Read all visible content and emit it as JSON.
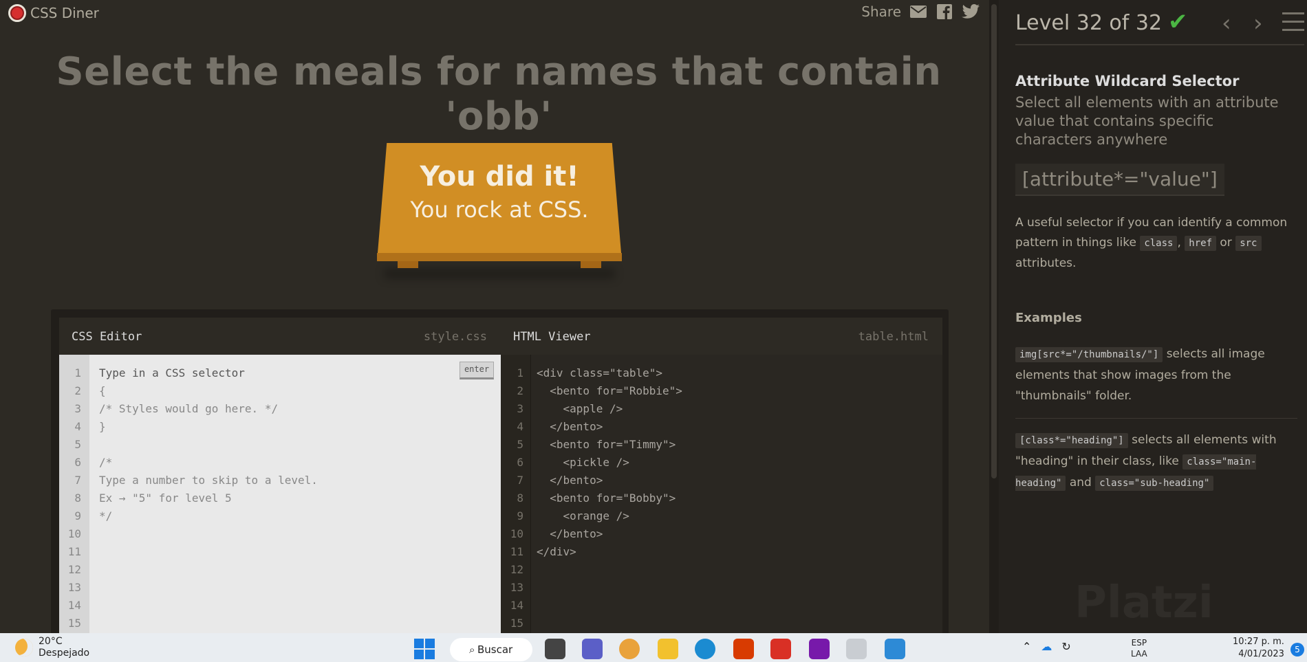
{
  "app": {
    "name": "CSS Diner"
  },
  "share": {
    "label": "Share"
  },
  "instruction": "Select the meals for names that contain 'obb'",
  "plate": {
    "line1": "You did it!",
    "line2": "You rock at CSS."
  },
  "css_editor": {
    "title": "CSS Editor",
    "filename": "style.css",
    "enter_label": "enter",
    "line_numbers": [
      "1",
      "2",
      "3",
      "4",
      "5",
      "6",
      "7",
      "8",
      "9",
      "10",
      "11",
      "12",
      "13",
      "14",
      "15"
    ],
    "lines": [
      "Type in a CSS selector",
      "{",
      "/* Styles would go here. */",
      "}",
      "",
      "/*",
      "Type a number to skip to a level.",
      "Ex → \"5\" for level 5",
      "*/",
      "",
      "",
      "",
      "",
      "",
      ""
    ]
  },
  "html_viewer": {
    "title": "HTML Viewer",
    "filename": "table.html",
    "line_numbers": [
      "1",
      "2",
      "3",
      "4",
      "5",
      "6",
      "7",
      "8",
      "9",
      "10",
      "11",
      "12",
      "13",
      "14",
      "15"
    ],
    "lines": [
      "<div class=\"table\">",
      "  <bento for=\"Robbie\">",
      "    <apple />",
      "  </bento>",
      "  <bento for=\"Timmy\">",
      "    <pickle />",
      "  </bento>",
      "  <bento for=\"Bobby\">",
      "    <orange />",
      "  </bento>",
      "</div>",
      "",
      "",
      "",
      ""
    ]
  },
  "sidebar": {
    "level": "Level 32 of 32",
    "selector_name": "Attribute Wildcard Selector",
    "selector_desc": "Select all elements with an attribute value that contains specific characters anywhere",
    "syntax": "[attribute*=\"value\"]",
    "hint_pre": "A useful selector if you can identify a common pattern in things like",
    "hint_code1": "class",
    "hint_comma": ",",
    "hint_code2": "href",
    "hint_or": "or",
    "hint_code3": "src",
    "hint_post": "attributes.",
    "examples_title": "Examples",
    "ex1_code": "img[src*=\"/thumbnails/\"]",
    "ex1_text": "selects all image elements that show images from the \"thumbnails\" folder.",
    "ex2_code": "[class*=\"heading\"]",
    "ex2_text": "selects all elements with \"heading\" in their class, like",
    "ex2_code2": "class=\"main-heading\"",
    "ex2_and": "and",
    "ex2_code3": "class=\"sub-heading\"",
    "watermark": "Platzi"
  },
  "taskbar": {
    "temp": "20°C",
    "weather": "Despejado",
    "search_label": "Buscar",
    "lang1": "ESP",
    "lang2": "LAA",
    "time": "10:27 p. m.",
    "date": "4/01/2023",
    "notifications": "5"
  },
  "colors": {
    "accent_green": "#4bb543",
    "table_orange": "#d18e24",
    "background": "#2d2a24"
  }
}
